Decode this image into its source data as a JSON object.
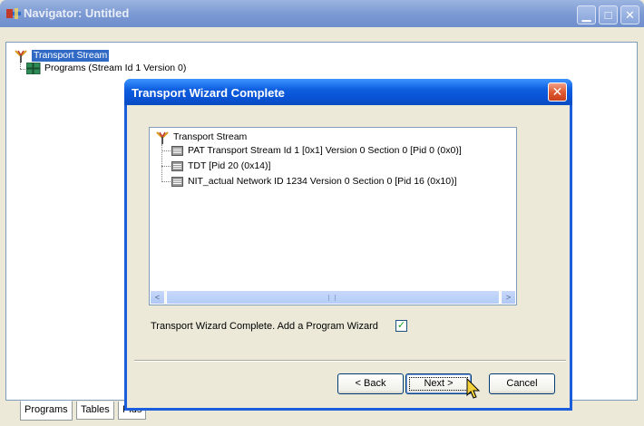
{
  "window": {
    "title": "Navigator: Untitled",
    "min_glyph": "▁",
    "max_glyph": "□",
    "close_glyph": "✕"
  },
  "navigator_tree": {
    "root_label": "Transport Stream",
    "root_icon": "antenna-icon",
    "child_label": "Programs (Stream Id 1 Version 0)",
    "child_icon": "programs-grid-icon"
  },
  "tabs": [
    {
      "label": "Programs",
      "active": true
    },
    {
      "label": "Tables",
      "active": false
    },
    {
      "label": "Pids",
      "active": false
    }
  ],
  "dialog": {
    "title": "Transport Wizard Complete",
    "close_glyph": "✕",
    "tree": {
      "root_label": "Transport Stream",
      "items": [
        {
          "label": "PAT Transport Stream Id    1 [0x1] Version  0 Section  0 [Pid 0 (0x0)]",
          "icon": "table-icon"
        },
        {
          "label": "TDT [Pid  20 (0x14)]",
          "icon": "table-icon"
        },
        {
          "label": "NIT_actual Network ID  1234 Version  0 Section  0 [Pid 16 (0x10)]",
          "icon": "table-icon"
        }
      ]
    },
    "scroll_left": "<",
    "scroll_right": ">",
    "checkbox_label": "Transport Wizard Complete.  Add a Program Wizard",
    "checkbox_checked": true,
    "checkbox_mark": "✓",
    "buttons": {
      "back": "< Back",
      "next": "Next >",
      "cancel": "Cancel"
    }
  },
  "colors": {
    "selection": "#316ac5",
    "dialog_title": "#0853d6",
    "main_title_inactive": "#7a98d2"
  }
}
